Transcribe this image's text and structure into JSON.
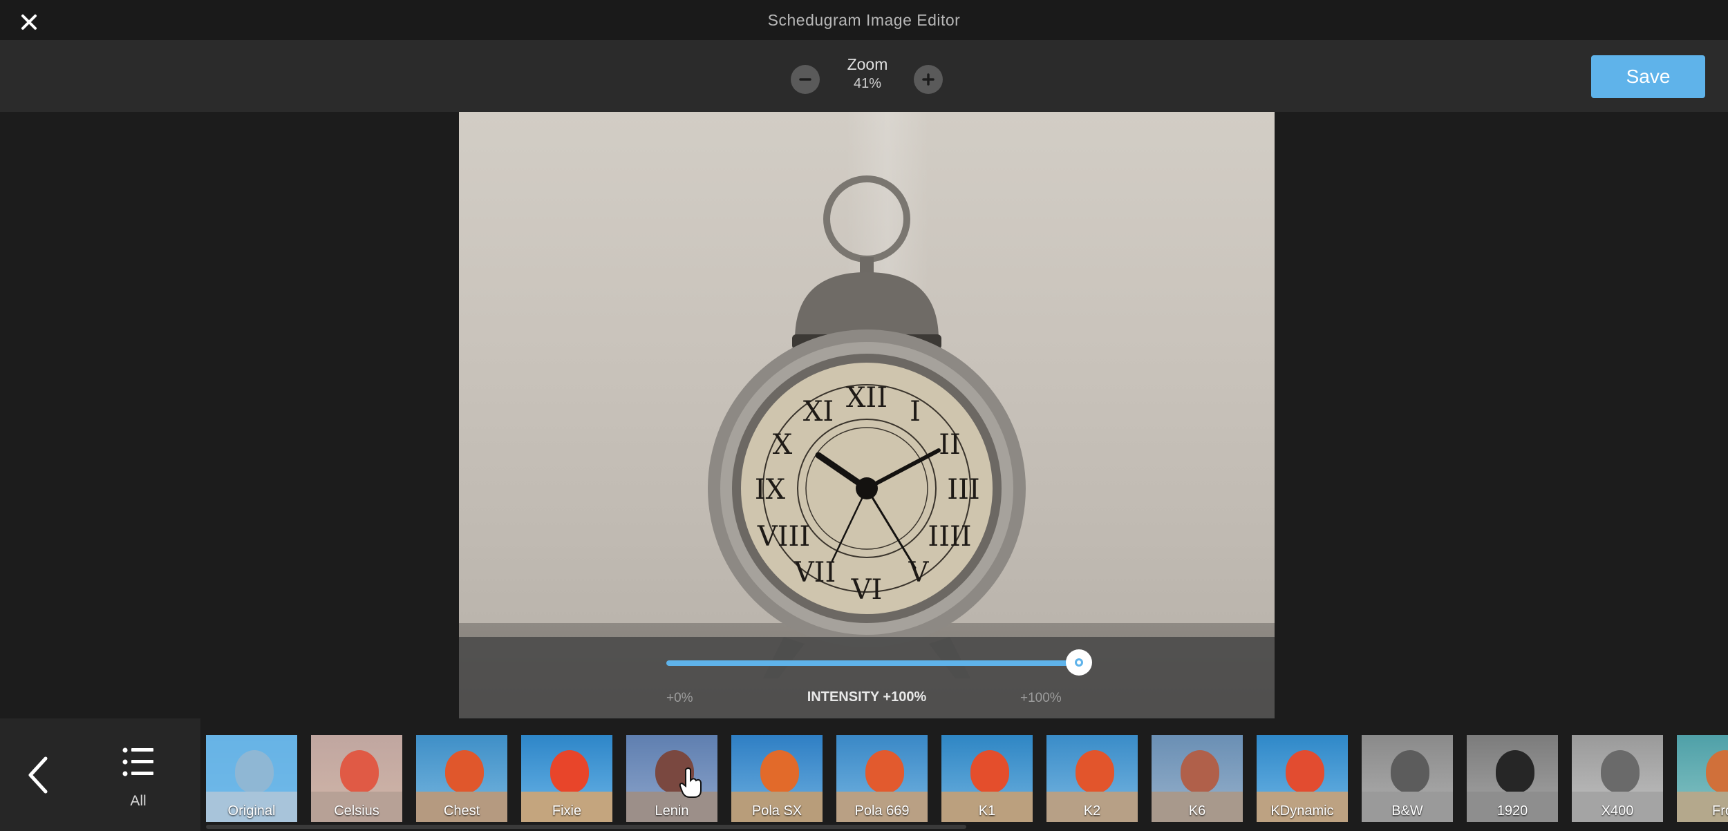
{
  "window": {
    "title": "Schedugram Image Editor"
  },
  "toolbar": {
    "zoom_label": "Zoom",
    "zoom_value": "41%",
    "save_label": "Save"
  },
  "intensity": {
    "min_label": "+0%",
    "label": "INTENSITY +100%",
    "max_label": "+100%",
    "value_percent": 100
  },
  "filter_strip": {
    "all_label": "All"
  },
  "filters": [
    {
      "label": "Original",
      "selected": true
    },
    {
      "label": "Celsius",
      "selected": false
    },
    {
      "label": "Chest",
      "selected": false
    },
    {
      "label": "Fixie",
      "selected": false
    },
    {
      "label": "Lenin",
      "selected": false
    },
    {
      "label": "Pola SX",
      "selected": false
    },
    {
      "label": "Pola 669",
      "selected": false
    },
    {
      "label": "K1",
      "selected": false
    },
    {
      "label": "K2",
      "selected": false
    },
    {
      "label": "K6",
      "selected": false
    },
    {
      "label": "KDynamic",
      "selected": false
    },
    {
      "label": "B&W",
      "selected": false
    },
    {
      "label": "1920",
      "selected": false
    },
    {
      "label": "X400",
      "selected": false
    },
    {
      "label": "Fro",
      "selected": false
    }
  ],
  "colors": {
    "accent": "#5fb3ea",
    "toolbar_bg": "#2b2b2b",
    "app_bg": "#1c1c1c"
  }
}
